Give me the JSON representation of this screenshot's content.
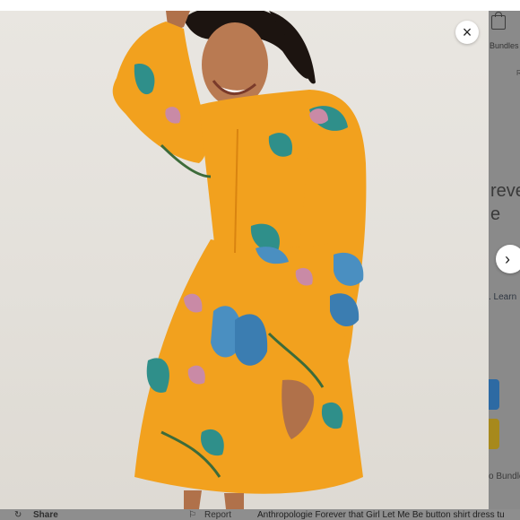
{
  "overlay": {
    "close_icon": "×",
    "next_icon": "›"
  },
  "background_page": {
    "bundles_label": "Bundles",
    "r_label": "R",
    "title_fragment_1": "reve",
    "title_fragment_2": "e",
    "learn_fragment": ". Learn",
    "bundle_fragment": "o Bundle",
    "colors": {
      "buy_button": "#2d6aa3",
      "offer_button": "#a7891c"
    }
  },
  "bottom_bar": {
    "share_icon": "↻",
    "share_label": "Share",
    "report_icon": "⚐",
    "report_label": "Report",
    "item_title": "Anthropologie Forever that Girl Let Me Be button shirt dress tu"
  },
  "photo": {
    "subject": "woman-in-orange-floral-dress-icon",
    "colors": {
      "dress": "#f2a11e",
      "leaf": "#2f8f8a",
      "pattern_blue": "#4a8fc1",
      "pattern_pink": "#c98aa6"
    }
  }
}
